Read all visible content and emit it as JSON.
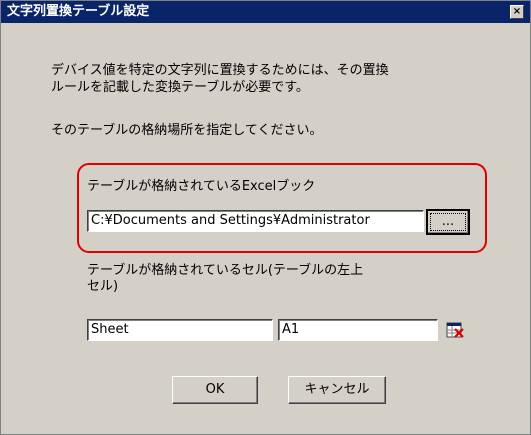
{
  "window": {
    "title": "文字列置換テーブル設定",
    "close_glyph": "×"
  },
  "description": {
    "line1": "デバイス値を特定の文字列に置換するためには、その置換",
    "line2": "ルールを記載した変換テーブルが必要です。",
    "line3": "そのテーブルの格納場所を指定してください。"
  },
  "workbook": {
    "label": "テーブルが格納されているExcelブック",
    "path_value": "C:¥Documents and Settings¥Administrator",
    "browse_label": "..."
  },
  "cell": {
    "label_line1": "テーブルが格納されているセル(テーブルの左上",
    "label_line2": "セル)",
    "sheet_value": "Sheet",
    "cell_value": "A1"
  },
  "buttons": {
    "ok_label": "OK",
    "cancel_label": "キャンセル"
  },
  "colors": {
    "title_bar": "#0a246a",
    "dialog_face": "#d4d0c8",
    "highlight_border": "#e00000"
  },
  "icons": {
    "sheet_picker": "sheet-picker-icon"
  }
}
